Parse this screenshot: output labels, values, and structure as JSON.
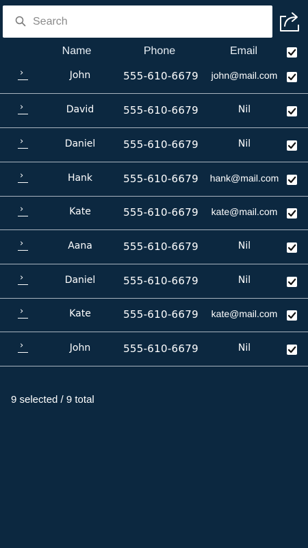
{
  "search": {
    "placeholder": "Search",
    "value": ""
  },
  "toolbar": {
    "share_icon": "share-export-icon"
  },
  "table": {
    "columns": {
      "name": "Name",
      "phone": "Phone",
      "email": "Email"
    },
    "select_all_checked": true,
    "rows": [
      {
        "name": "John",
        "phone": "555-610-6679",
        "email": "john@mail.com",
        "checked": true
      },
      {
        "name": "David",
        "phone": "555-610-6679",
        "email": "Nil",
        "checked": true
      },
      {
        "name": "Daniel",
        "phone": "555-610-6679",
        "email": "Nil",
        "checked": true
      },
      {
        "name": "Hank",
        "phone": "555-610-6679",
        "email": "hank@mail.com",
        "checked": true
      },
      {
        "name": "Kate",
        "phone": "555-610-6679",
        "email": "kate@mail.com",
        "checked": true
      },
      {
        "name": "Aana",
        "phone": "555-610-6679",
        "email": "Nil",
        "checked": true
      },
      {
        "name": "Daniel",
        "phone": "555-610-6679",
        "email": "Nil",
        "checked": true
      },
      {
        "name": "Kate",
        "phone": "555-610-6679",
        "email": "kate@mail.com",
        "checked": true
      },
      {
        "name": "John",
        "phone": "555-610-6679",
        "email": "Nil",
        "checked": true
      }
    ]
  },
  "status": {
    "text": "9 selected / 9 total"
  },
  "colors": {
    "background": "#0c2840",
    "divider": "#aab5c0",
    "text": "#ffffff"
  }
}
